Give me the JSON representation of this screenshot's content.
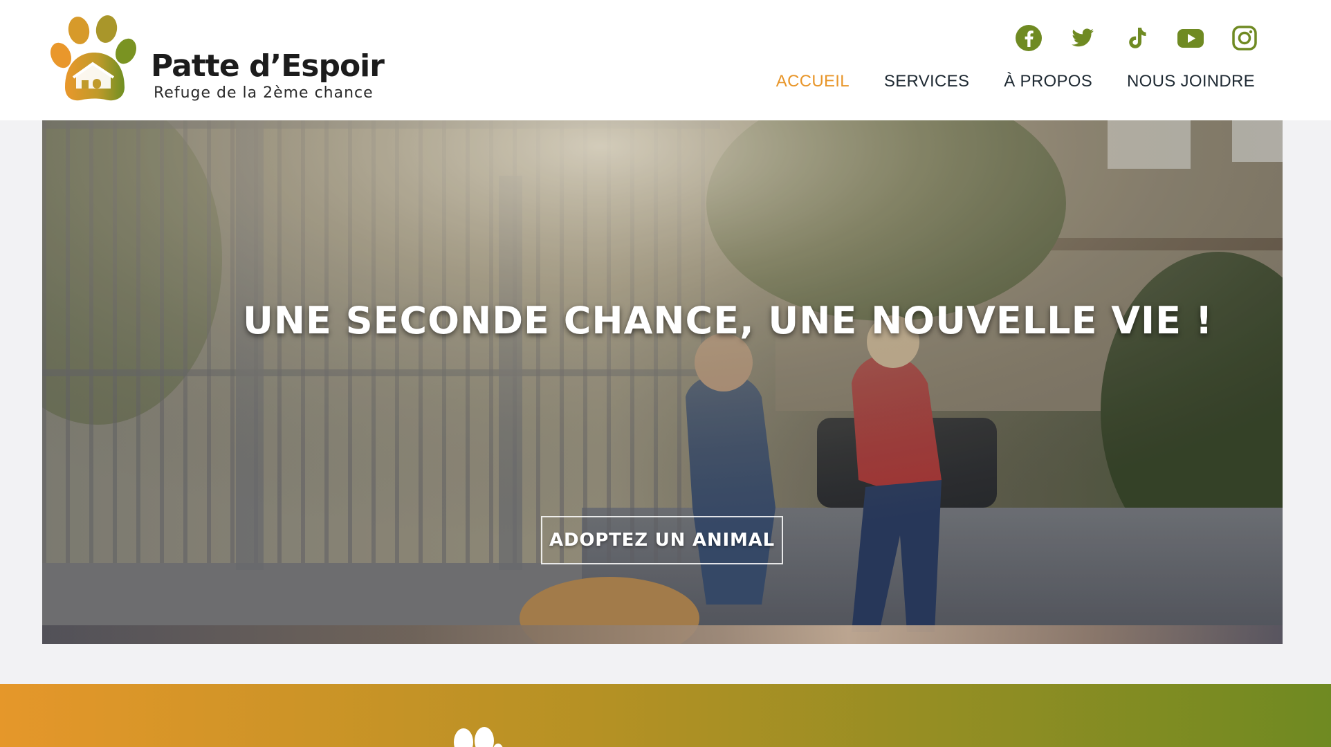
{
  "brand": {
    "title": "Patte d’Espoir",
    "subtitle": "Refuge de la 2ème chance",
    "colors": {
      "orange": "#e8962a",
      "green": "#6f8a22",
      "dark_text": "#1f2a33"
    }
  },
  "socials": [
    {
      "name": "facebook",
      "icon": "facebook-icon"
    },
    {
      "name": "twitter",
      "icon": "twitter-icon"
    },
    {
      "name": "tiktok",
      "icon": "tiktok-icon"
    },
    {
      "name": "youtube",
      "icon": "youtube-icon"
    },
    {
      "name": "instagram",
      "icon": "instagram-icon"
    }
  ],
  "nav": {
    "items": [
      {
        "label": "ACCUEIL",
        "active": true
      },
      {
        "label": "SERVICES",
        "active": false
      },
      {
        "label": "À PROPOS",
        "active": false
      },
      {
        "label": "NOUS JOINDRE",
        "active": false
      }
    ]
  },
  "hero": {
    "title": "UNE SECONDE CHANCE, UNE NOUVELLE VIE !",
    "cta_label": "ADOPTEZ UN ANIMAL"
  }
}
